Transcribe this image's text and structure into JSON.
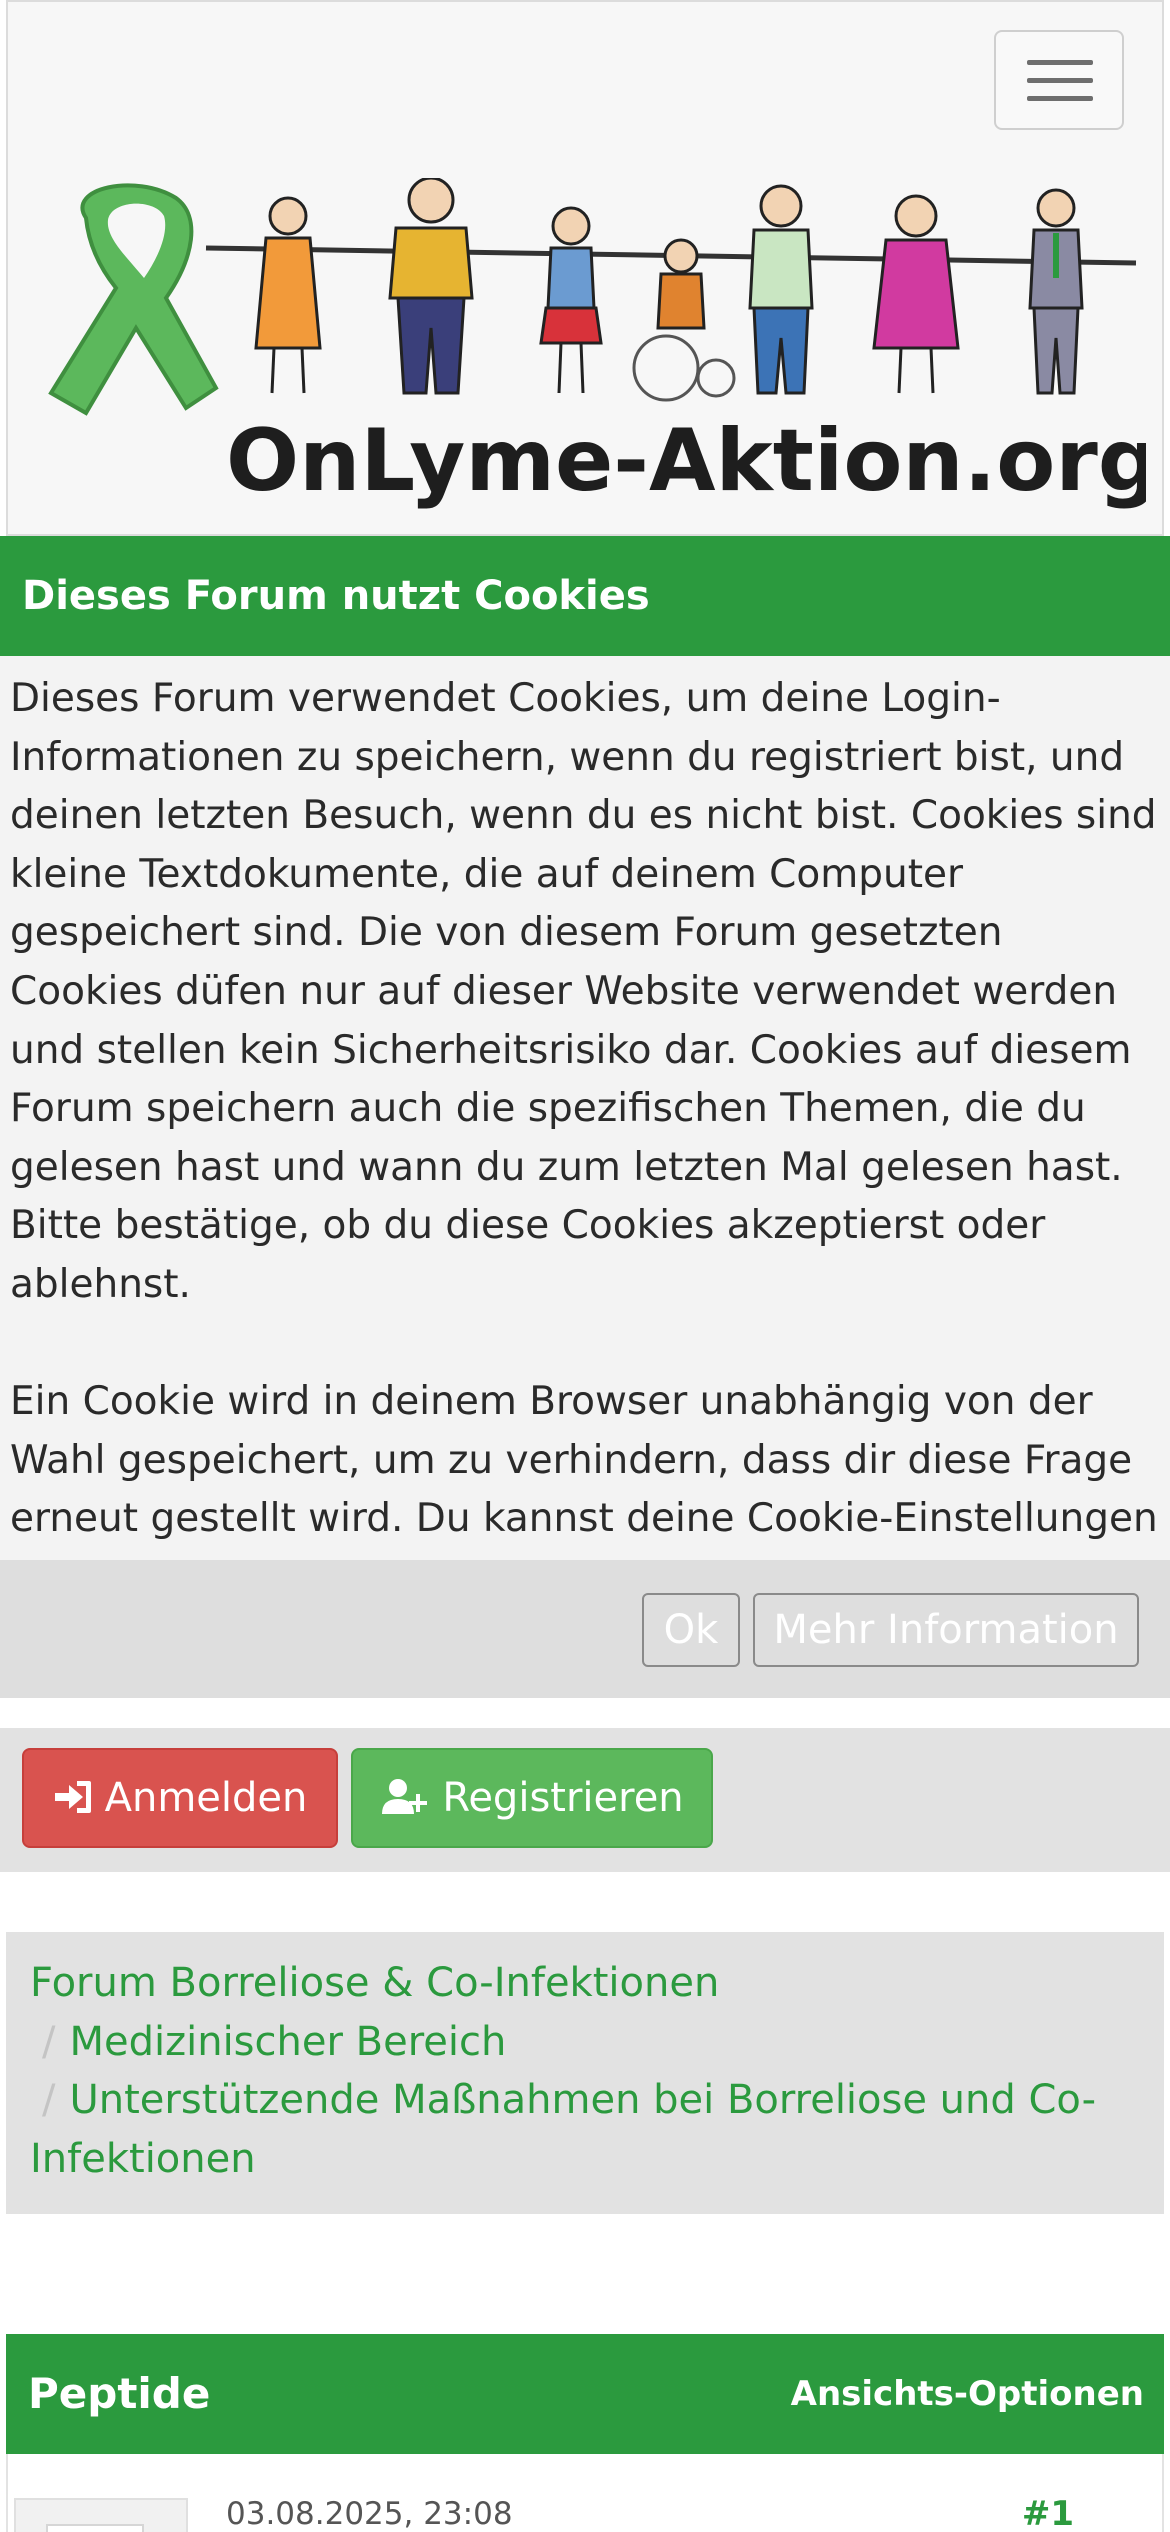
{
  "header": {
    "logo_text": "OnLyme-Aktion.org",
    "menu_toggle": "menu"
  },
  "cookie_notice": {
    "title": "Dieses Forum nutzt Cookies",
    "paragraph1": "Dieses Forum verwendet Cookies, um deine Login-Informationen zu speichern, wenn du registriert bist, und deinen letzten Besuch, wenn du es nicht bist. Cookies sind kleine Textdokumente, die auf deinem Computer gespeichert sind. Die von diesem Forum gesetzten Cookies düfen nur auf dieser Website verwendet werden und stellen kein Sicherheitsrisiko dar. Cookies auf diesem Forum speichern auch die spezifischen Themen, die du gelesen hast und wann du zum letzten Mal gelesen hast. Bitte bestätige, ob du diese Cookies akzeptierst oder ablehnst.",
    "paragraph2": "Ein Cookie wird in deinem Browser unabhängig von der Wahl gespeichert, um zu verhindern, dass dir diese Frage erneut gestellt wird. Du kannst deine Cookie-Einstellungen jederzeit über den Link in der Fußzeile ändern.",
    "ok_label": "Ok",
    "more_label": "Mehr Information"
  },
  "auth": {
    "login_label": "Anmelden",
    "register_label": "Registrieren",
    "login_icon": "sign-in-icon",
    "register_icon": "user-plus-icon"
  },
  "breadcrumb": {
    "separator": "/",
    "items": [
      "Forum Borreliose & Co-Infektionen",
      "Medizinischer Bereich",
      "Unterstützende Maßnahmen bei Borreliose und Co-Infektionen"
    ]
  },
  "thread": {
    "title": "Peptide",
    "options_label": "Ansichts-Optionen"
  },
  "post": {
    "date": "03.08.2025, 23:08",
    "number": "#1"
  },
  "colors": {
    "brand_green": "#2b9a3e",
    "login_red": "#d9534f",
    "register_green": "#5cb85c"
  }
}
